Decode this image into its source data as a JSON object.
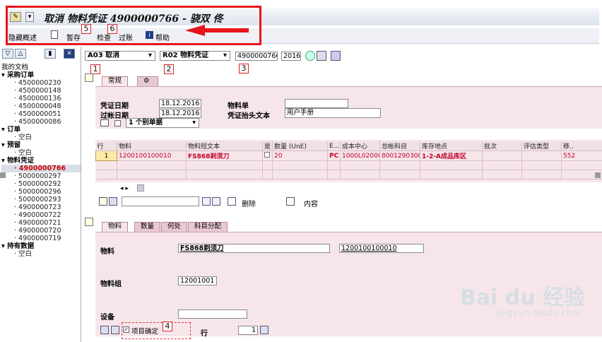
{
  "window": {
    "title": "取消 物料凭证 4900000766 - 骁双 佟"
  },
  "toolbar": {
    "items": [
      "隐藏概述",
      "暂存",
      "检查",
      "过账",
      "帮助"
    ]
  },
  "callouts": [
    "1",
    "2",
    "3",
    "4",
    "5",
    "6"
  ],
  "sidebar": {
    "title": "我的文档",
    "groups": [
      {
        "label": "采购订单",
        "items": [
          "4500000230",
          "4500000148",
          "4500000136",
          "4500000048",
          "4500000051",
          "4500000086"
        ]
      },
      {
        "label": "订单",
        "items": [
          "空白"
        ]
      },
      {
        "label": "预留",
        "items": [
          "空白"
        ]
      },
      {
        "label": "物料凭证",
        "items": [
          "4900000766",
          "5000000297",
          "5000000292",
          "5000000296",
          "5000000293",
          "4900000723",
          "4900000722",
          "4900000721",
          "4900000720",
          "4900000719"
        ]
      },
      {
        "label": "持有数据",
        "items": [
          "空白"
        ]
      }
    ],
    "selected_item": "4900000766"
  },
  "header": {
    "action": "A03 取消",
    "reference": "R02 物料凭证",
    "doc_number": "4900000766",
    "year": "2016"
  },
  "header_tabs": [
    "常规"
  ],
  "general": {
    "doc_date_label": "凭证日期",
    "doc_date": "18.12.2016",
    "post_date_label": "过帐日期",
    "post_date": "18.12.2016",
    "material_slip_label": "物料单",
    "material_slip": "",
    "header_text_label": "凭证抬头文本",
    "header_text": "用户手册",
    "print_option": "1 个别单据"
  },
  "grid": {
    "columns": [
      "行",
      "物料",
      "物料短文本",
      "是",
      "数量 (UnE)",
      "E...",
      "成本中心",
      "总帐科目",
      "库存地点",
      "批次",
      "评估类型",
      "移.."
    ],
    "rows": [
      [
        "1",
        "1200100100010",
        "FS868剃须刀",
        "",
        "20",
        "PC",
        "1000L02000",
        "8001290300",
        "1-2-A成品库区",
        "",
        "",
        "552"
      ]
    ]
  },
  "grid_toolbar": {
    "delete": "删除",
    "content": "内容"
  },
  "detail_tabs": [
    "物料",
    "数量",
    "何处",
    "科目分配"
  ],
  "detail": {
    "material_label": "物料",
    "material_name": "FS868剃须刀",
    "material_code": "1200100100010",
    "group_label": "物料组",
    "group_value": "12001001",
    "device_label": "设备",
    "device_value": ""
  },
  "footer": {
    "item_ok_label": "项目确定",
    "line_label": "行",
    "line_value": "1"
  },
  "watermark": {
    "main": "Bai du 经验",
    "sub": "jingyan.baidu.com"
  },
  "colors": {
    "annotation_red": "#e8151b",
    "pink_panel": "#f6e6ea",
    "selected_text": "#c00000"
  }
}
